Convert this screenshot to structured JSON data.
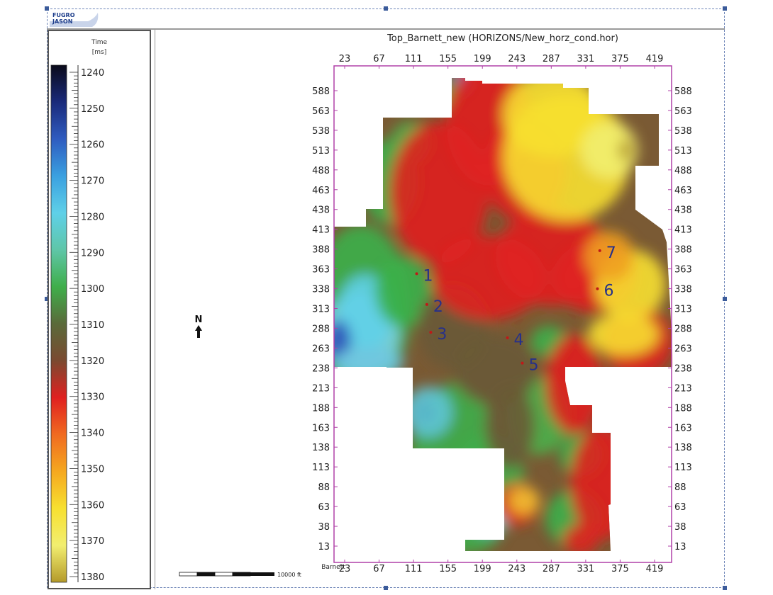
{
  "logo": {
    "line1": "FUGRO",
    "line2": "JASON"
  },
  "colorbar": {
    "title": "Time",
    "unit": "[ms]",
    "ticks": [
      "1240",
      "1250",
      "1260",
      "1270",
      "1280",
      "1290",
      "1300",
      "1310",
      "1320",
      "1330",
      "1340",
      "1350",
      "1360",
      "1370",
      "1380"
    ],
    "colors": [
      "#0a0a1a",
      "#1a2a7a",
      "#2f5cc0",
      "#3aa0e0",
      "#5fd0e8",
      "#5fc6a8",
      "#3fae4a",
      "#5a6a3a",
      "#7a4a30",
      "#e02020",
      "#f06a20",
      "#f5a81f",
      "#f7e030",
      "#f2ee70",
      "#b49a2a"
    ]
  },
  "map": {
    "title": "Top_Barnett_new (HORIZONS/New_horz_cond.hor)",
    "x_ticks": [
      "23",
      "67",
      "111",
      "155",
      "199",
      "243",
      "287",
      "331",
      "375",
      "419"
    ],
    "y_ticks": [
      "588",
      "563",
      "538",
      "513",
      "488",
      "463",
      "438",
      "413",
      "388",
      "363",
      "338",
      "313",
      "288",
      "263",
      "238",
      "213",
      "188",
      "163",
      "138",
      "113",
      "88",
      "63",
      "38",
      "13"
    ],
    "bottom_label": "Barnett",
    "north": "N",
    "scale_label": "10000 ft",
    "well_labels": [
      "1",
      "2",
      "3",
      "4",
      "5",
      "6",
      "7"
    ]
  },
  "chart_data": {
    "type": "heatmap",
    "title": "Top_Barnett_new (HORIZONS/New_horz_cond.hor)",
    "x_ticks": [
      23,
      67,
      111,
      155,
      199,
      243,
      287,
      331,
      375,
      419
    ],
    "y_ticks": [
      588,
      563,
      538,
      513,
      488,
      463,
      438,
      413,
      388,
      363,
      338,
      313,
      288,
      263,
      238,
      213,
      188,
      163,
      138,
      113,
      88,
      63,
      38,
      13
    ],
    "colorbar": {
      "label": "Time [ms]",
      "range": [
        1240,
        1380
      ]
    },
    "wells": [
      {
        "name": "1",
        "x": 115,
        "y": 357
      },
      {
        "name": "2",
        "x": 128,
        "y": 318
      },
      {
        "name": "3",
        "x": 133,
        "y": 283
      },
      {
        "name": "4",
        "x": 231,
        "y": 276
      },
      {
        "name": "5",
        "x": 250,
        "y": 244
      },
      {
        "name": "6",
        "x": 346,
        "y": 338
      },
      {
        "name": "7",
        "x": 349,
        "y": 386
      }
    ]
  }
}
